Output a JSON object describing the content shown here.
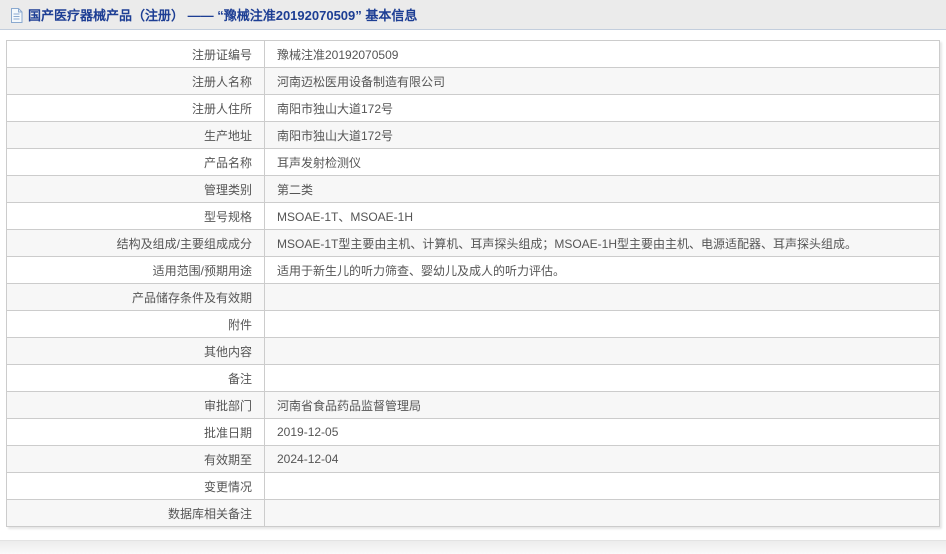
{
  "header": {
    "icon": "document-icon",
    "title": "国产医疗器械产品（注册） —— “豫械注准20192070509” 基本信息"
  },
  "table": {
    "rows": [
      {
        "label": "注册证编号",
        "value": "豫械注准20192070509"
      },
      {
        "label": "注册人名称",
        "value": "河南迈松医用设备制造有限公司"
      },
      {
        "label": "注册人住所",
        "value": "南阳市独山大道172号"
      },
      {
        "label": "生产地址",
        "value": "南阳市独山大道172号"
      },
      {
        "label": "产品名称",
        "value": "耳声发射检测仪"
      },
      {
        "label": "管理类别",
        "value": "第二类"
      },
      {
        "label": "型号规格",
        "value": "MSOAE-1T、MSOAE-1H"
      },
      {
        "label": "结构及组成/主要组成成分",
        "value": "MSOAE-1T型主要由主机、计算机、耳声探头组成；MSOAE-1H型主要由主机、电源适配器、耳声探头组成。"
      },
      {
        "label": "适用范围/预期用途",
        "value": "适用于新生儿的听力筛查、婴幼儿及成人的听力评估。"
      },
      {
        "label": "产品储存条件及有效期",
        "value": ""
      },
      {
        "label": "附件",
        "value": ""
      },
      {
        "label": "其他内容",
        "value": ""
      },
      {
        "label": "备注",
        "value": ""
      },
      {
        "label": "审批部门",
        "value": "河南省食品药品监督管理局"
      },
      {
        "label": "批准日期",
        "value": "2019-12-05"
      },
      {
        "label": "有效期至",
        "value": "2024-12-04"
      },
      {
        "label": "变更情况",
        "value": ""
      },
      {
        "label": "数据库相关备注",
        "value": ""
      }
    ]
  },
  "colors": {
    "title_text": "#1d3e94",
    "header_bg": "#ebebeb",
    "header_border": "#c3cedd",
    "table_border": "#cccccc",
    "row_alt_bg": "#f7f7f7",
    "body_text": "#555555"
  }
}
